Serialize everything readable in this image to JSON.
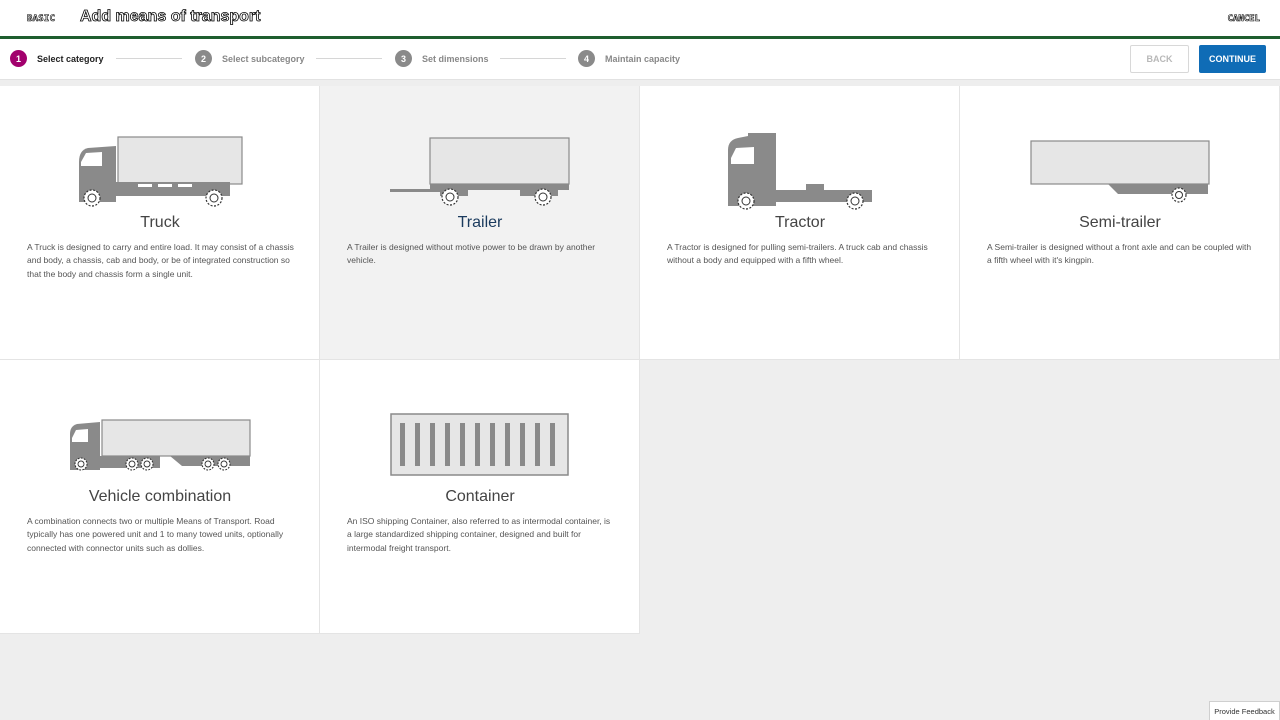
{
  "header": {
    "back_label": "BASIC",
    "title": "Add means of transport",
    "cancel_label": "CANCEL"
  },
  "steps": [
    {
      "number": "1",
      "label": "Select category",
      "active": true
    },
    {
      "number": "2",
      "label": "Select subcategory",
      "active": false
    },
    {
      "number": "3",
      "label": "Set dimensions",
      "active": false
    },
    {
      "number": "4",
      "label": "Maintain capacity",
      "active": false
    }
  ],
  "actions": {
    "back_label": "BACK",
    "continue_label": "CONTINUE"
  },
  "categories": [
    {
      "name": "Truck",
      "icon": "truck-icon",
      "description": "A Truck is designed to carry and entire load. It may consist of a chassis and body, a chassis, cab and body, or be of integrated construction so that the body and chassis form a single unit."
    },
    {
      "name": "Trailer",
      "icon": "trailer-icon",
      "description": "A Trailer is designed without motive power to be drawn by another vehicle."
    },
    {
      "name": "Tractor",
      "icon": "tractor-icon",
      "description": "A Tractor is designed for pulling semi-trailers. A truck cab and chassis without a body and equipped with a fifth wheel."
    },
    {
      "name": "Semi-trailer",
      "icon": "semi-trailer-icon",
      "description": "A Semi-trailer is designed without a front axle and can be coupled with a fifth wheel with it's kingpin."
    },
    {
      "name": "Vehicle combination",
      "icon": "vehicle-combination-icon",
      "description": "A combination connects two or multiple Means of Transport. Road typically has one powered unit and 1 to many towed units, optionally connected with connector units such as dollies."
    },
    {
      "name": "Container",
      "icon": "container-icon",
      "description": "An ISO shipping Container, also referred to as intermodal container, is a large standardized shipping container, designed and built for intermodal freight transport."
    }
  ],
  "feedback_label": "Provide Feedback",
  "colors": {
    "accent_step": "#a2006d",
    "primary_button": "#0f6cb6",
    "header_line": "#1e5e2e",
    "icon_gray": "#8a8a8a"
  }
}
